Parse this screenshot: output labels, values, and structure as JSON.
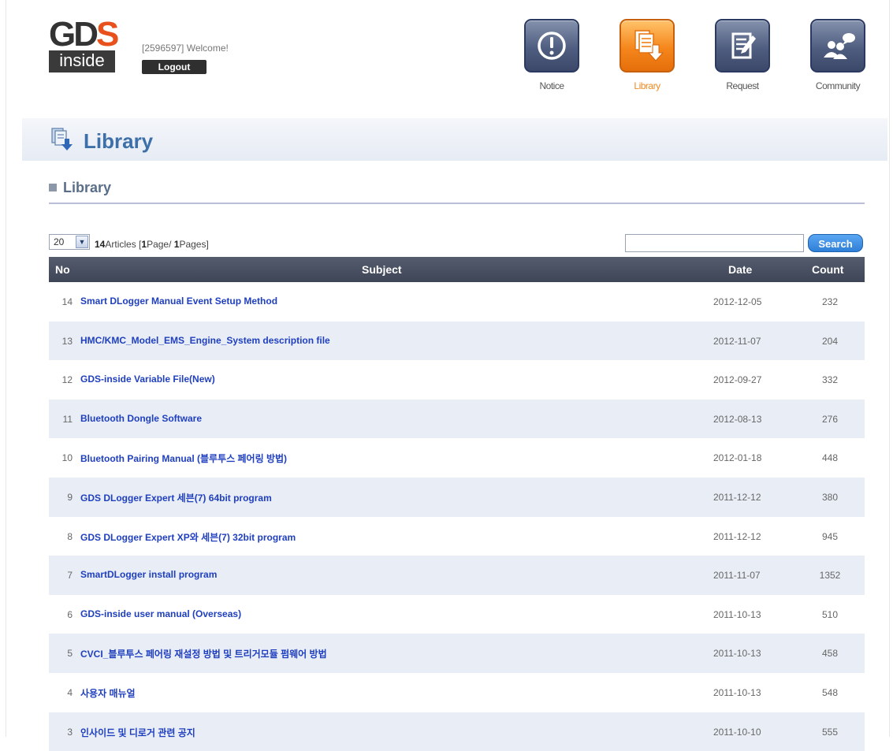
{
  "header": {
    "logo_top": "GD",
    "logo_s": "S",
    "logo_bottom": "inside",
    "welcome": "[2596597] Welcome!",
    "logout_label": "Logout",
    "nav": [
      {
        "label": "Notice",
        "icon": "notice-icon",
        "active": false
      },
      {
        "label": "Library",
        "icon": "library-icon",
        "active": true
      },
      {
        "label": "Request",
        "icon": "request-icon",
        "active": false
      },
      {
        "label": "Community",
        "icon": "community-icon",
        "active": false
      }
    ]
  },
  "banner": {
    "title": "Library"
  },
  "section": {
    "heading": "Library"
  },
  "toolbar": {
    "per_page": "20",
    "info": {
      "count": "14",
      "count_suffix": "Articles [",
      "page": "1",
      "page_suffix": "Page/ ",
      "pages": "1",
      "pages_suffix": "Pages]"
    },
    "search_placeholder": "",
    "search_label": "Search"
  },
  "table": {
    "headers": {
      "no": "No",
      "subject": "Subject",
      "date": "Date",
      "count": "Count"
    },
    "rows": [
      {
        "no": "14",
        "subject": "Smart DLogger Manual Event Setup Method",
        "date": "2012-12-05",
        "count": "232"
      },
      {
        "no": "13",
        "subject": "HMC/KMC_Model_EMS_Engine_System description file",
        "date": "2012-11-07",
        "count": "204"
      },
      {
        "no": "12",
        "subject": "GDS-inside Variable File(New)",
        "date": "2012-09-27",
        "count": "332"
      },
      {
        "no": "11",
        "subject": "Bluetooth Dongle Software",
        "date": "2012-08-13",
        "count": "276"
      },
      {
        "no": "10",
        "subject": "Bluetooth Pairing Manual (블루투스 페어링 방법)",
        "date": "2012-01-18",
        "count": "448"
      },
      {
        "no": "9",
        "subject": "GDS DLogger Expert 세븐(7) 64bit program",
        "date": "2011-12-12",
        "count": "380"
      },
      {
        "no": "8",
        "subject": "GDS DLogger Expert XP와 세븐(7) 32bit program",
        "date": "2011-12-12",
        "count": "945"
      },
      {
        "no": "7",
        "subject": "SmartDLogger install program",
        "date": "2011-11-07",
        "count": "1352"
      },
      {
        "no": "6",
        "subject": "GDS-inside user manual (Overseas)",
        "date": "2011-10-13",
        "count": "510"
      },
      {
        "no": "5",
        "subject": "CVCI_블루투스 페어링 재설정 방법 및 트리거모듈 펌웨어 방법",
        "date": "2011-10-13",
        "count": "458"
      },
      {
        "no": "4",
        "subject": "사용자 매뉴얼",
        "date": "2011-10-13",
        "count": "548"
      },
      {
        "no": "3",
        "subject": "인사이드 및 디로거 관련 공지",
        "date": "2011-10-10",
        "count": "555"
      }
    ]
  },
  "colors": {
    "accent": "#f5861c",
    "nav": "#4f5d80",
    "link": "#1f3fbf",
    "banner_title": "#3d6fa8"
  }
}
